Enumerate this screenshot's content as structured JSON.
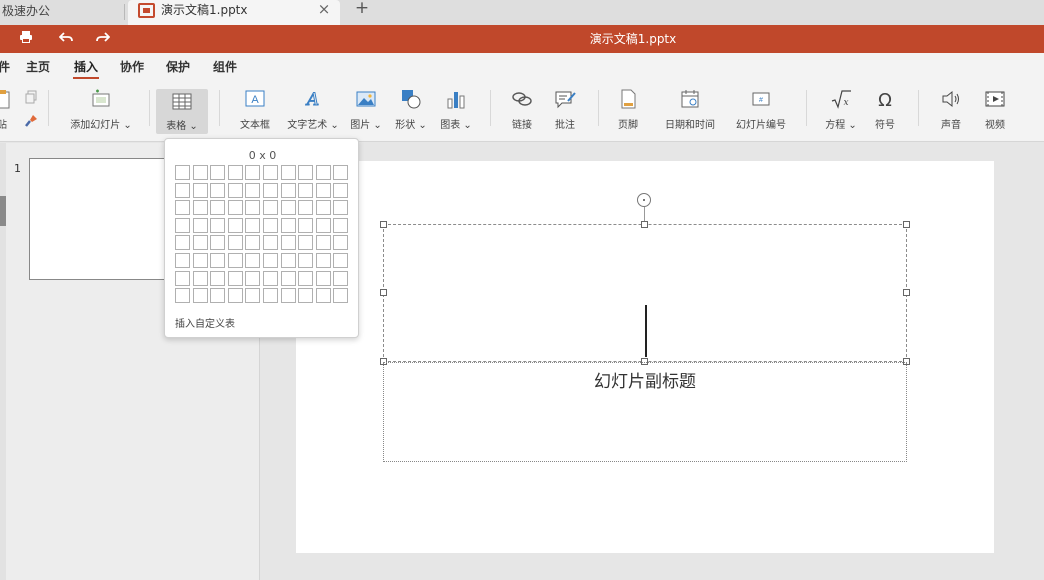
{
  "tabs": {
    "home_label": "极速办公",
    "active_title": "演示文稿1.pptx",
    "close_glyph": "×",
    "add_glyph": "+"
  },
  "titlebar": {
    "doc_title": "演示文稿1.pptx",
    "color": "#c0482b"
  },
  "menu": {
    "items": [
      "件",
      "主页",
      "插入",
      "协作",
      "保护",
      "组件"
    ],
    "active_index": 2
  },
  "ribbon": {
    "paste_label": "贴",
    "add_slide": "添加幻灯片 ⌄",
    "table": "表格 ⌄",
    "textbox": "文本框",
    "text_art": "文字艺术 ⌄",
    "image": "图片 ⌄",
    "shape": "形状 ⌄",
    "chart": "图表 ⌄",
    "link": "链接",
    "comment": "批注",
    "footer": "页脚",
    "datetime": "日期和时间",
    "slide_number": "幻灯片编号",
    "equation": "方程 ⌄",
    "symbol": "符号",
    "audio": "声音",
    "video": "视频"
  },
  "table_dropdown": {
    "size_label": "0 x 0",
    "rows": 8,
    "cols": 10,
    "custom_label": "插入自定义表"
  },
  "slides_panel": {
    "slide_number": "1"
  },
  "slide": {
    "subtitle_placeholder": "幻灯片副标题"
  }
}
